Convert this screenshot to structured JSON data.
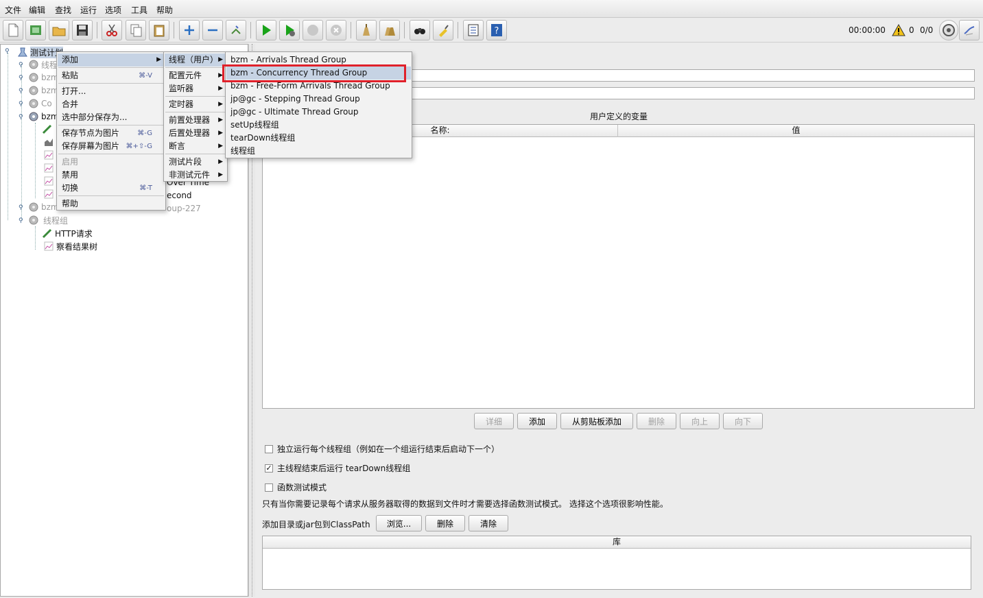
{
  "menubar": [
    "文件",
    "编辑",
    "查找",
    "运行",
    "选项",
    "工具",
    "帮助"
  ],
  "status": {
    "timer": "00:00:00",
    "warnings": "0",
    "threads": "0/0"
  },
  "tree": {
    "root": "测试计划",
    "items": [
      {
        "label": "线程",
        "dim": true
      },
      {
        "label": "bzm",
        "dim": true
      },
      {
        "label": "bzm",
        "dim": true
      },
      {
        "label": "Co",
        "dim": true
      },
      {
        "label": "bzm",
        "dim": false
      },
      {
        "label": "Over Time",
        "dim": false
      },
      {
        "label": "econd",
        "dim": false
      },
      {
        "label": "bzm",
        "dim": true
      },
      {
        "label": "oup-227",
        "dim": true
      },
      {
        "label": "线程组",
        "dim": true
      },
      {
        "label": "HTTP请求",
        "dim": false
      },
      {
        "label": "察看结果树",
        "dim": false
      }
    ]
  },
  "context_menu": {
    "items": [
      {
        "label": "添加",
        "shortcut": "",
        "submenu": true,
        "highlight": true
      },
      {
        "label": "粘贴",
        "shortcut": "⌘-V"
      },
      {
        "label": "打开...",
        "shortcut": ""
      },
      {
        "label": "合并",
        "shortcut": ""
      },
      {
        "label": "选中部分保存为...",
        "shortcut": ""
      },
      {
        "label": "保存节点为图片",
        "shortcut": "⌘-G"
      },
      {
        "label": "保存屏幕为图片",
        "shortcut": "⌘+⇧-G"
      },
      {
        "label": "启用",
        "shortcut": "",
        "disabled": true
      },
      {
        "label": "禁用",
        "shortcut": ""
      },
      {
        "label": "切换",
        "shortcut": "⌘-T"
      },
      {
        "label": "帮助",
        "shortcut": ""
      }
    ]
  },
  "add_menu": {
    "items": [
      "线程（用户）",
      "配置元件",
      "监听器",
      "定时器",
      "前置处理器",
      "后置处理器",
      "断言",
      "测试片段",
      "非测试元件"
    ]
  },
  "thread_menu": {
    "items": [
      "bzm - Arrivals Thread Group",
      "bzm - Concurrency Thread Group",
      "bzm - Free-Form Arrivals Thread Group",
      "jp@gc - Stepping Thread Group",
      "jp@gc - Ultimate Thread Group",
      "setUp线程组",
      "tearDown线程组",
      "线程组"
    ],
    "selected_index": 1
  },
  "right_panel": {
    "variables_title": "用户定义的变量",
    "col_name": "名称:",
    "col_value": "值",
    "buttons": {
      "detail": "详细",
      "add": "添加",
      "add_clipboard": "从剪贴板添加",
      "delete": "删除",
      "up": "向上",
      "down": "向下"
    },
    "checkboxes": {
      "serial": "独立运行每个线程组（例如在一个组运行结束后启动下一个）",
      "teardown": "主线程结束后运行 tearDown线程组",
      "functional": "函数测试模式"
    },
    "functional_note": "只有当你需要记录每个请求从服务器取得的数据到文件时才需要选择函数测试模式。 选择这个选项很影响性能。",
    "classpath_label": "添加目录或jar包到ClassPath",
    "classpath_buttons": {
      "browse": "浏览...",
      "delete": "删除",
      "clear": "清除"
    },
    "library_header": "库"
  },
  "colors": {
    "accent": "#c6d3e4",
    "highlight_box": "#e0202a"
  }
}
